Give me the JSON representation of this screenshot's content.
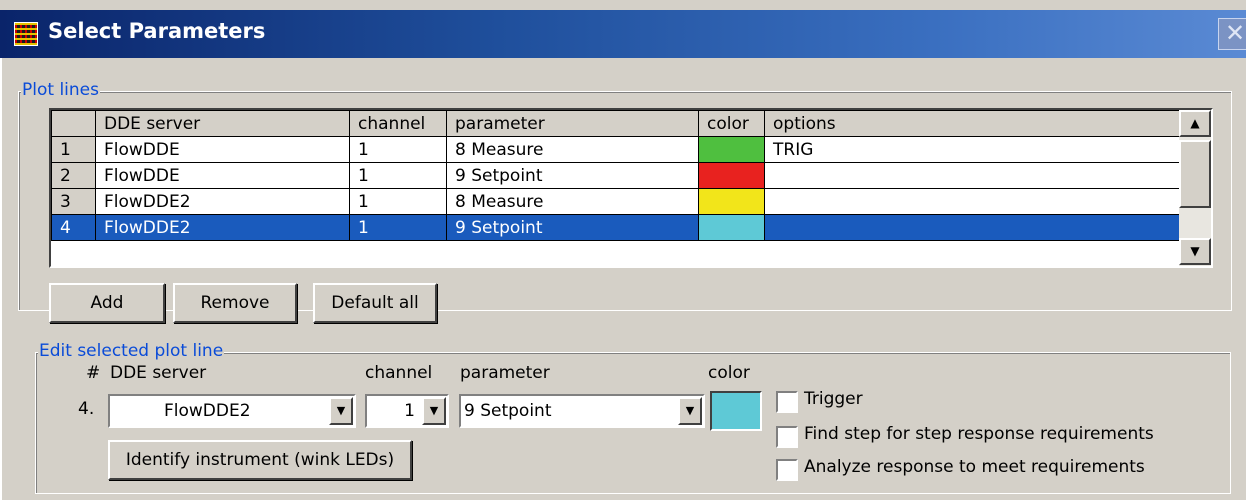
{
  "window": {
    "title": "Select Parameters",
    "close_glyph": "✕",
    "icon": "plot-grid-icon"
  },
  "plot_lines": {
    "legend": "Plot lines",
    "columns": [
      "",
      "DDE server",
      "channel",
      "parameter",
      "color",
      "options"
    ],
    "rows": [
      {
        "num": "1",
        "server": "FlowDDE",
        "channel": "1",
        "parameter": "8 Measure",
        "color": "#4fbf3f",
        "options": "TRIG"
      },
      {
        "num": "2",
        "server": "FlowDDE",
        "channel": "1",
        "parameter": "9 Setpoint",
        "color": "#e8221f",
        "options": ""
      },
      {
        "num": "3",
        "server": "FlowDDE2",
        "channel": "1",
        "parameter": "8 Measure",
        "color": "#f2e51a",
        "options": ""
      },
      {
        "num": "4",
        "server": "FlowDDE2",
        "channel": "1",
        "parameter": "9 Setpoint",
        "color": "#5ec9d6",
        "options": ""
      }
    ],
    "selected_row": "4",
    "buttons": {
      "add": "Add",
      "remove": "Remove",
      "default_all": "Default all"
    }
  },
  "edit": {
    "legend": "Edit selected plot line",
    "headers": {
      "num": "#",
      "server": "DDE server",
      "channel": "channel",
      "parameter": "parameter",
      "color": "color"
    },
    "row_num": "4.",
    "server_value": "FlowDDE2",
    "channel_value": "1",
    "parameter_value": "9 Setpoint",
    "color_value": "#5ec9d6",
    "identify_button": "Identify instrument (wink LEDs)",
    "checkboxes": [
      {
        "label": "Trigger",
        "checked": false
      },
      {
        "label": "Find step for step response requirements",
        "checked": false
      },
      {
        "label": "Analyze response to meet requirements",
        "checked": false
      }
    ]
  }
}
